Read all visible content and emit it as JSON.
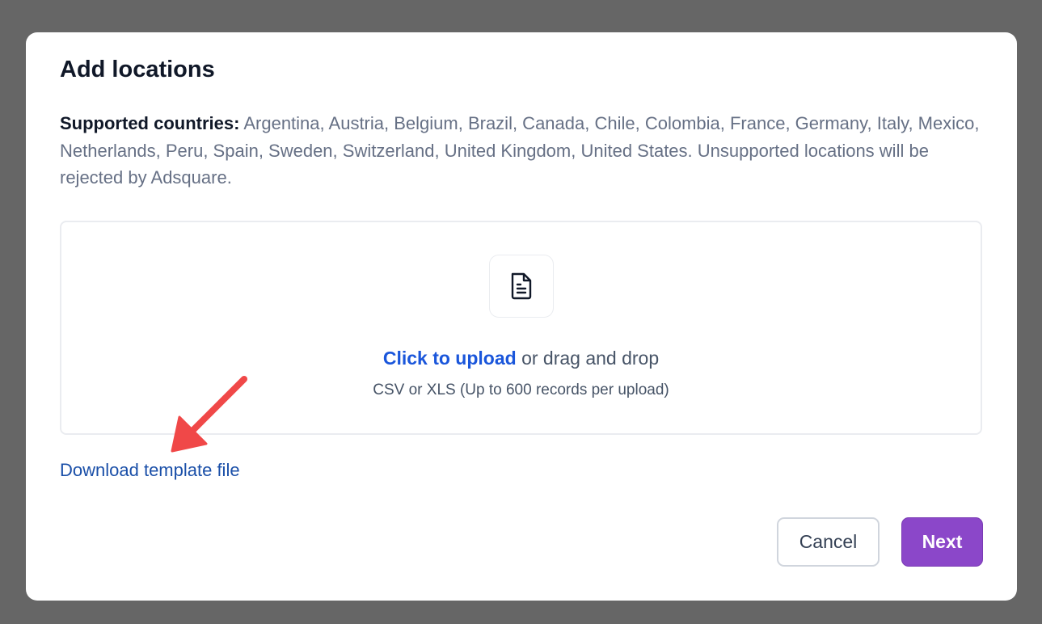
{
  "modal": {
    "title": "Add locations",
    "supported_label": "Supported countries:",
    "supported_text": " Argentina, Austria, Belgium, Brazil, Canada, Chile, Colombia, France, Germany, Italy, Mexico, Netherlands, Peru, Spain, Sweden, Switzerland, United Kingdom, United States. Unsupported locations will be rejected by Adsquare."
  },
  "upload": {
    "icon": "file-text-icon",
    "link_label": "Click to upload",
    "rest_label": " or drag and drop",
    "hint": "CSV or XLS (Up to 600 records per upload)"
  },
  "download_link": "Download template file",
  "annotation": {
    "icon": "arrow-annotation-icon",
    "color": "#f04848"
  },
  "buttons": {
    "cancel": "Cancel",
    "next": "Next"
  },
  "colors": {
    "accent": "#8b47c9",
    "link": "#1a56db"
  }
}
